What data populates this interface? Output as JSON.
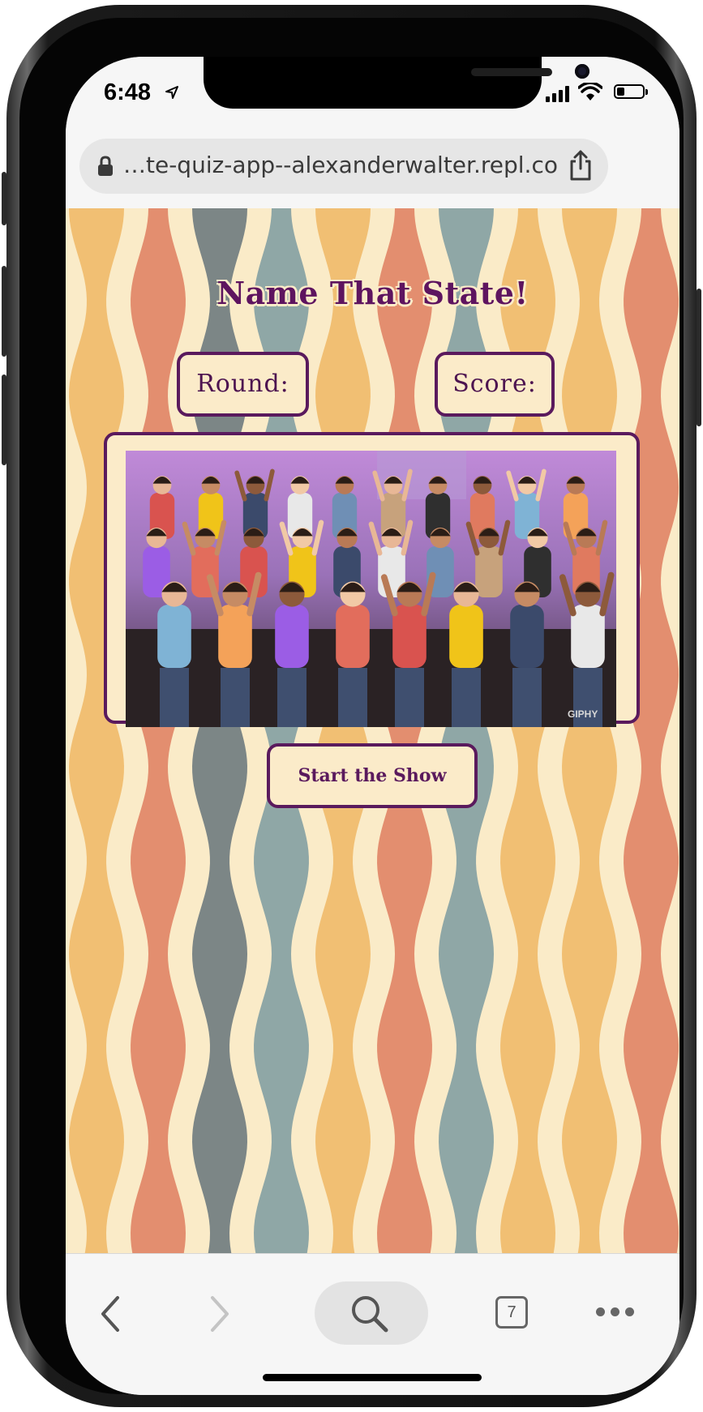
{
  "status_bar": {
    "time": "6:48"
  },
  "browser": {
    "url_display": "…te-quiz-app--alexanderwalter.repl.co"
  },
  "page": {
    "title": "Name That State!",
    "round_label": "Round:",
    "score_label": "Score:",
    "gif_watermark": "GIPHY",
    "start_button": "Start the Show"
  },
  "toolbar": {
    "tab_count": "7"
  },
  "colors": {
    "accent_purple": "#5a1a5d",
    "cream": "#fbebc9",
    "pattern_orange": "#f1bf73",
    "pattern_terracotta": "#e38e6f",
    "pattern_teal": "#8fa7a6",
    "pattern_gray": "#7c8686"
  }
}
